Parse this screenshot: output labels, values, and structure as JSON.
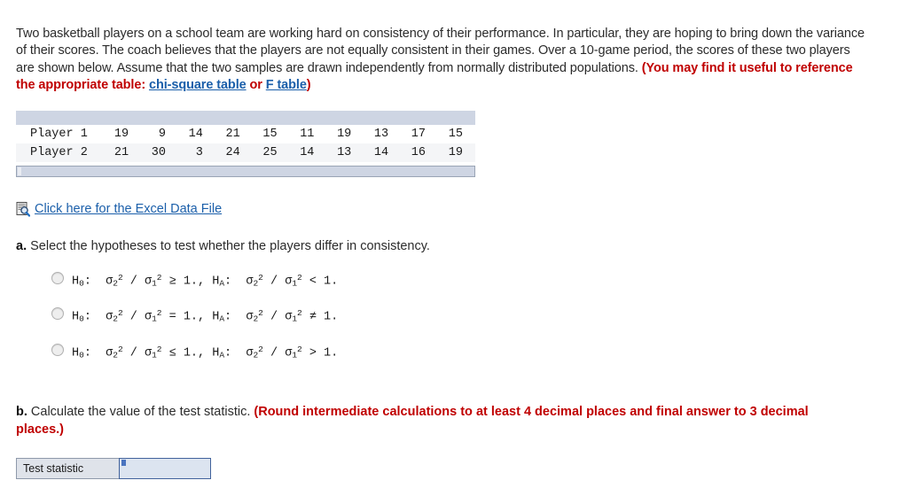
{
  "intro": {
    "text_before_hint": "Two basketball players on a school team are working hard on consistency of their performance. In particular, they are hoping to bring down the variance of their scores. The coach believes that the players are not equally consistent in their games. Over a 10-game period, the scores of these two players are shown below. Assume that the two samples are drawn independently from normally distributed populations. ",
    "hint_open": "(You may find it useful to reference the appropriate table: ",
    "link_chi_square": "chi-square table",
    "hint_or": " or ",
    "link_f_table": "F table",
    "hint_close": ")"
  },
  "data_table": {
    "rows": [
      {
        "label": "Player 1",
        "values": [
          "19",
          "9",
          "14",
          "21",
          "15",
          "11",
          "19",
          "13",
          "17",
          "15"
        ]
      },
      {
        "label": "Player 2",
        "values": [
          "21",
          "30",
          "3",
          "24",
          "25",
          "14",
          "13",
          "14",
          "16",
          "19"
        ]
      }
    ]
  },
  "excel": {
    "icon": "excel-document-icon",
    "link_label": "Click here for the Excel Data File"
  },
  "part_a": {
    "marker": "a.",
    "prompt": " Select the hypotheses to test whether the players differ in consistency.",
    "options": [
      {
        "id": "option-1",
        "selected": false,
        "null_symbol": "H",
        "null_sub": "0",
        "null_rel": "≥",
        "alt_symbol": "H",
        "alt_sub": "A",
        "alt_rel": "<",
        "numerator_sub": "2",
        "denominator_sub": "1",
        "power": "2",
        "value": "1."
      },
      {
        "id": "option-2",
        "selected": false,
        "null_symbol": "H",
        "null_sub": "0",
        "null_rel": "=",
        "alt_symbol": "H",
        "alt_sub": "A",
        "alt_rel": "≠",
        "numerator_sub": "2",
        "denominator_sub": "1",
        "power": "2",
        "value": "1."
      },
      {
        "id": "option-3",
        "selected": false,
        "null_symbol": "H",
        "null_sub": "0",
        "null_rel": "≤",
        "alt_symbol": "H",
        "alt_sub": "A",
        "alt_rel": ">",
        "numerator_sub": "2",
        "denominator_sub": "1",
        "power": "2",
        "value": "1."
      }
    ],
    "sigma": "σ",
    "slash": "/",
    "colon": ":",
    "comma": ","
  },
  "part_b": {
    "marker": "b.",
    "prompt": " Calculate the value of the test statistic. ",
    "hint": "(Round intermediate calculations to at least 4 decimal places and final answer to 3 decimal places.)",
    "answer_label": "Test statistic",
    "answer_value": "",
    "answer_placeholder": ""
  },
  "colors": {
    "hint_red": "#c00000",
    "link_blue": "#1b5faa",
    "table_bar": "#ced5e3",
    "input_border": "#41629c",
    "input_fill": "#dce4f0"
  }
}
